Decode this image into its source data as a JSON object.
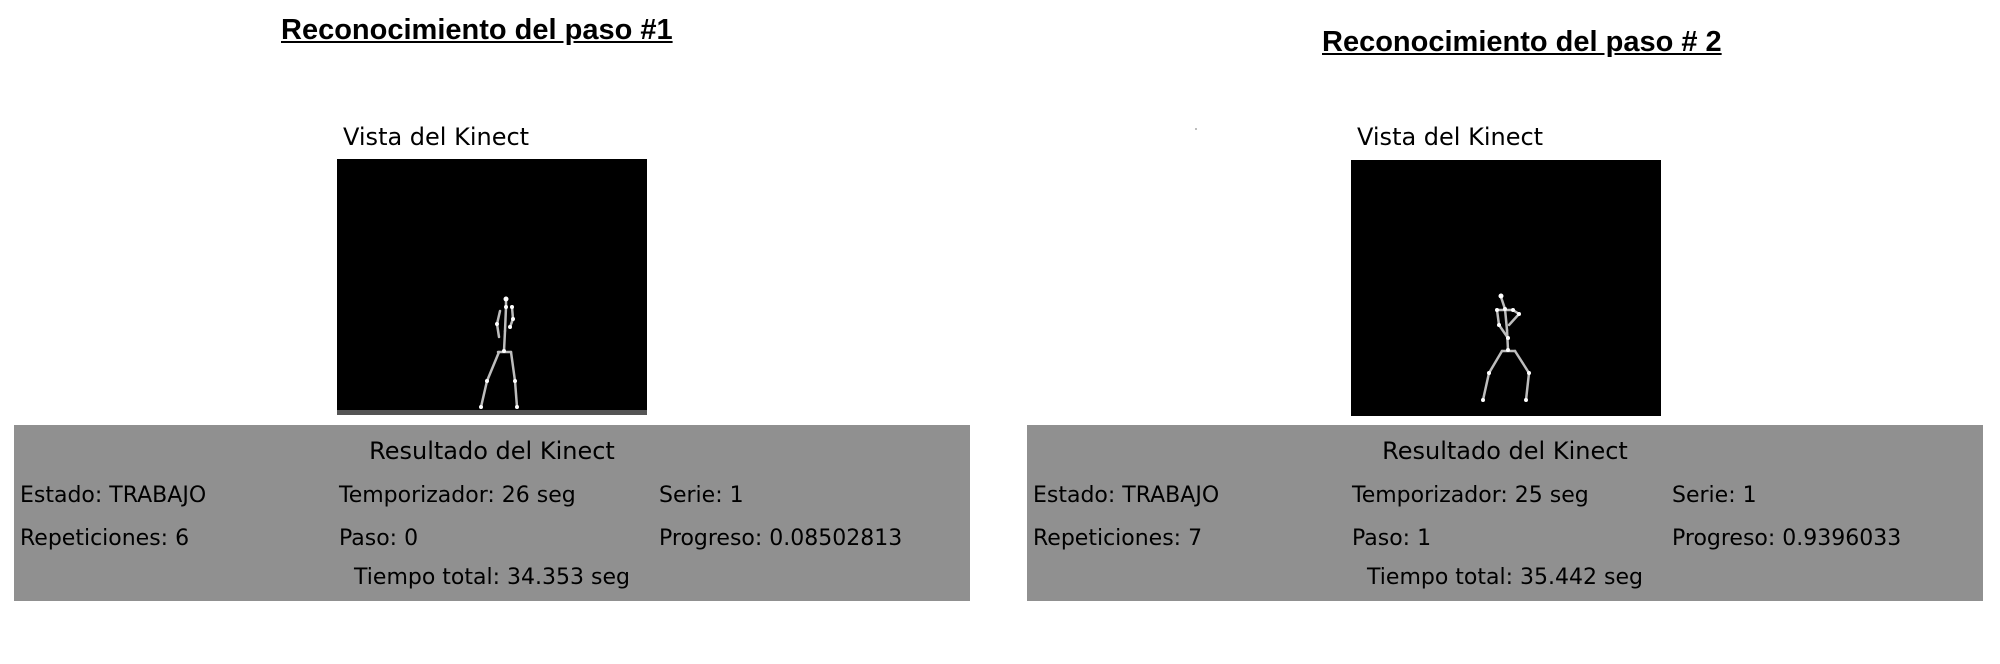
{
  "panels": [
    {
      "title": "Reconocimiento del paso #1",
      "view_label": "Vista del Kinect",
      "result_heading": "Resultado del Kinect",
      "estado": "Estado: TRABAJO",
      "temporizador": "Temporizador: 26 seg",
      "serie": "Serie: 1",
      "repeticiones": "Repeticiones: 6",
      "paso": "Paso: 0",
      "progreso": "Progreso: 0.08502813",
      "tiempo_total": "Tiempo total: 34.353 seg"
    },
    {
      "title": "Reconocimiento del paso # 2",
      "view_label": "Vista del Kinect",
      "result_heading": "Resultado del Kinect",
      "estado": "Estado: TRABAJO",
      "temporizador": "Temporizador: 25 seg",
      "serie": "Serie: 1",
      "repeticiones": "Repeticiones: 7",
      "paso": "Paso: 1",
      "progreso": "Progreso: 0.9396033",
      "tiempo_total": "Tiempo total: 35.442 seg"
    }
  ]
}
